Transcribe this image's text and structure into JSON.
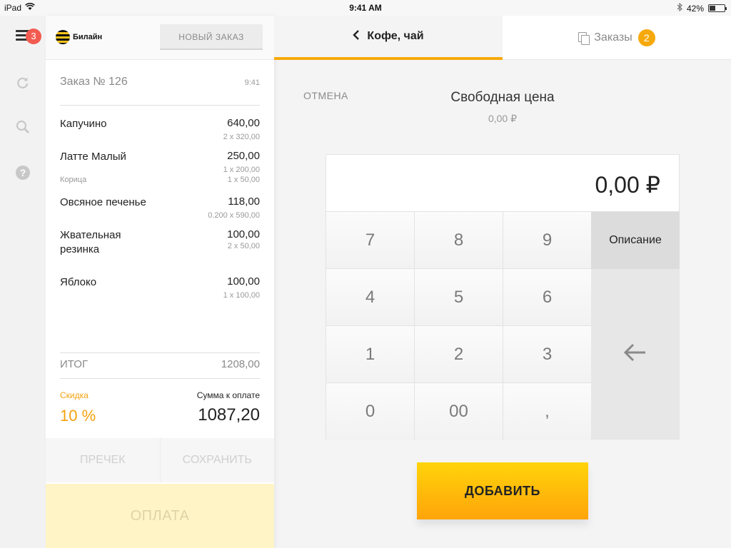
{
  "status_bar": {
    "device": "iPad",
    "time": "9:41 AM",
    "battery": "42%",
    "battery_level": 0.42
  },
  "rail": {
    "menu_badge": "3",
    "icons": [
      "refresh-icon",
      "search-icon",
      "help-icon"
    ]
  },
  "order_panel": {
    "brand": "Билайн",
    "new_order_label": "НОВЫЙ ЗАКАЗ",
    "order_title": "Заказ № 126",
    "order_time": "9:41",
    "items": [
      {
        "name": "Капучино",
        "price": "640,00",
        "detail": "2 x 320,00"
      },
      {
        "name": "Латте Малый",
        "price": "250,00",
        "detail": "1 x 200,00",
        "modifier_name": "Корица",
        "modifier_detail": "1 x 50,00"
      },
      {
        "name": "Овсяное печенье",
        "price": "118,00",
        "detail": "0.200 x 590,00"
      },
      {
        "name": "Жвательная резинка",
        "price": "100,00",
        "detail": "2 x 50,00"
      },
      {
        "name": "Яблоко",
        "price": "100,00",
        "detail": "1 x 100,00"
      }
    ],
    "total_label": "ИТОГ",
    "total_value": "1208,00",
    "discount_label": "Скидка",
    "discount_value": "10 %",
    "pay_sum_label": "Сумма к оплате",
    "pay_sum_value": "1087,20",
    "precheck_label": "ПРЕЧЕК",
    "save_label": "СОХРАНИТЬ",
    "pay_label": "ОПЛАТА"
  },
  "header": {
    "category_tab": "Кофе, чай",
    "orders_tab": "Заказы",
    "orders_count": "2"
  },
  "free_price": {
    "cancel_label": "ОТМЕНА",
    "title": "Свободная цена",
    "subtitle": "0,00 ₽",
    "display_value": "0,00 ₽",
    "keys": {
      "k7": "7",
      "k8": "8",
      "k9": "9",
      "k4": "4",
      "k5": "5",
      "k6": "6",
      "k1": "1",
      "k2": "2",
      "k3": "3",
      "k0": "0",
      "k00": "00",
      "kcomma": ","
    },
    "description_label": "Описание",
    "add_label": "ДОБАВИТЬ"
  },
  "colors": {
    "accent": "#f6a90c",
    "badge_red": "#f25b50",
    "add_button": "#ffc10a"
  }
}
